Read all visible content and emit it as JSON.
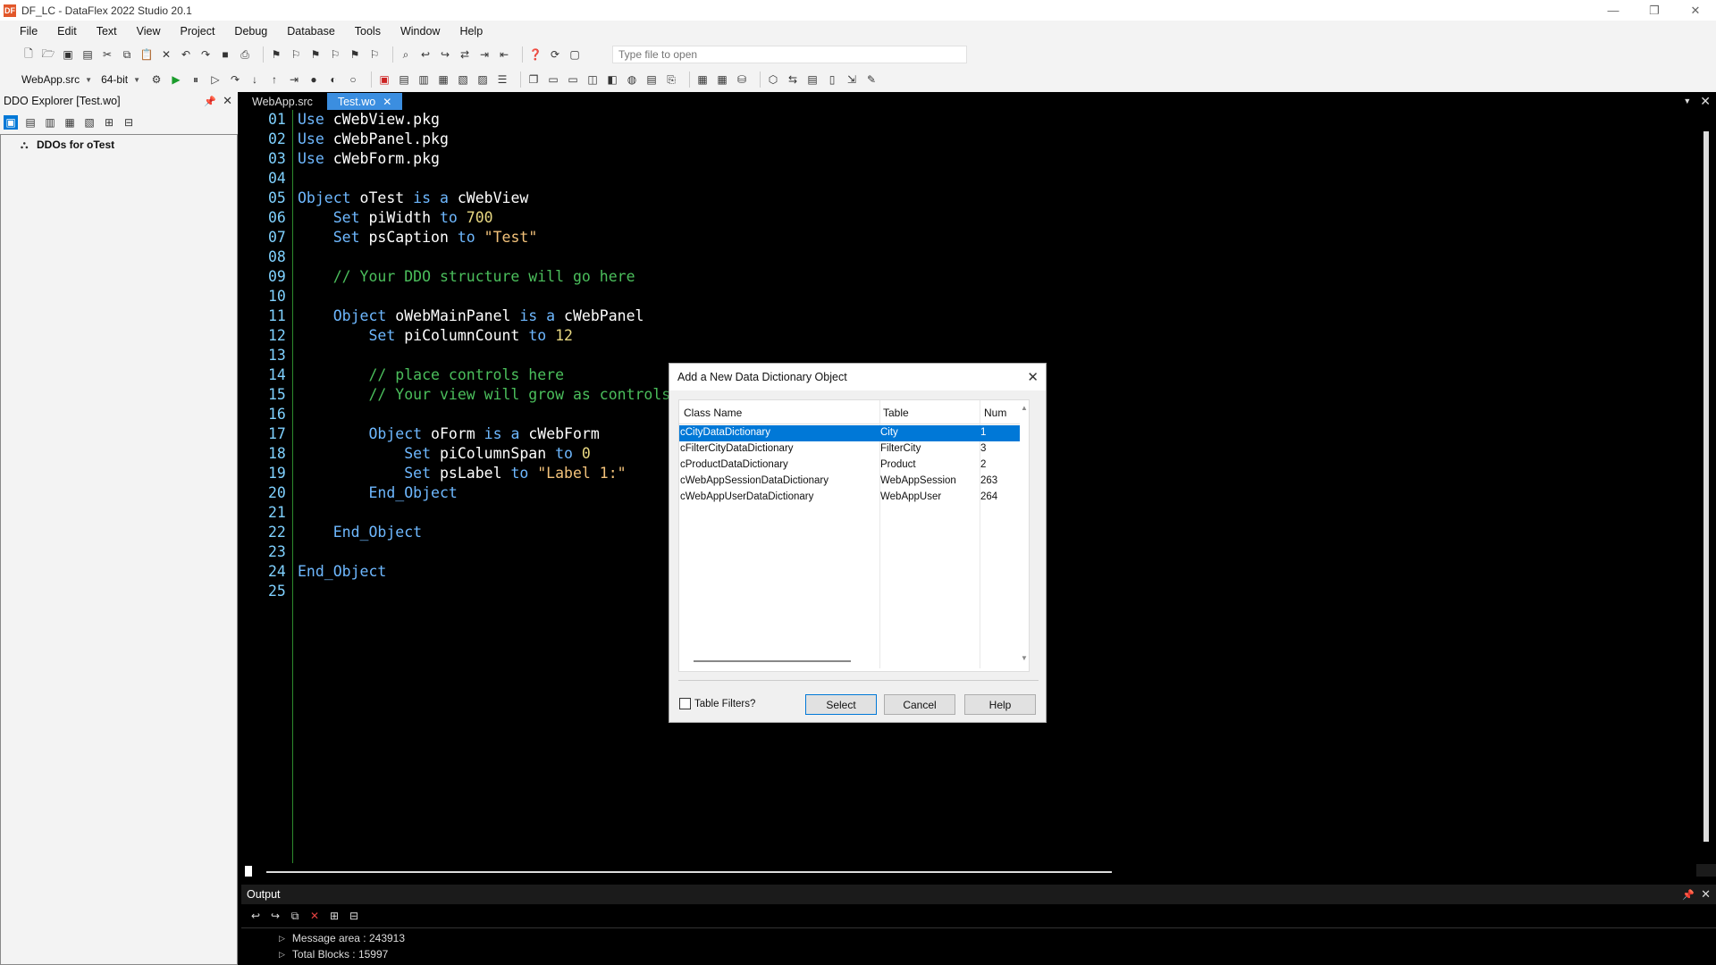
{
  "window": {
    "title": "DF_LC - DataFlex 2022 Studio 20.1",
    "app_icon": "DF",
    "controls": [
      "—",
      "❐",
      "✕"
    ]
  },
  "menu": [
    "File",
    "Edit",
    "Text",
    "View",
    "Project",
    "Debug",
    "Database",
    "Tools",
    "Window",
    "Help"
  ],
  "toolbar": {
    "open_file_placeholder": "Type file to open",
    "project_combo": "WebApp.src",
    "bitness_combo": "64-bit"
  },
  "ddo_explorer": {
    "title": "DDO Explorer [Test.wo]",
    "tree_root": "DDOs for oTest"
  },
  "tabs": [
    {
      "label": "WebApp.src",
      "active": false
    },
    {
      "label": "Test.wo",
      "active": true
    }
  ],
  "editor": {
    "line_numbers": [
      "01",
      "02",
      "03",
      "04",
      "05",
      "06",
      "07",
      "08",
      "09",
      "10",
      "11",
      "12",
      "13",
      "14",
      "15",
      "16",
      "17",
      "18",
      "19",
      "20",
      "21",
      "22",
      "23",
      "24",
      "25"
    ]
  },
  "output": {
    "title": "Output",
    "lines": [
      "Message area  : 243913",
      "Total Blocks  : 15997"
    ]
  },
  "dialog": {
    "title": "Add a New Data Dictionary Object",
    "columns": [
      "Class Name",
      "Table",
      "Num"
    ],
    "rows": [
      {
        "class": "cCityDataDictionary",
        "table": "City",
        "num": "1",
        "selected": true
      },
      {
        "class": "cFilterCityDataDictionary",
        "table": "FilterCity",
        "num": "3",
        "selected": false
      },
      {
        "class": "cProductDataDictionary",
        "table": "Product",
        "num": "2",
        "selected": false
      },
      {
        "class": "cWebAppSessionDataDictionary",
        "table": "WebAppSession",
        "num": "263",
        "selected": false
      },
      {
        "class": "cWebAppUserDataDictionary",
        "table": "WebAppUser",
        "num": "264",
        "selected": false
      }
    ],
    "table_filters_label": "Table Filters?",
    "select_label": "Select",
    "cancel_label": "Cancel",
    "help_label": "Help"
  },
  "colors": {
    "selection": "#0078d7",
    "active_tab": "#3b8ee0",
    "keyword": "#6eb8ff",
    "comment": "#4bbf5c",
    "string": "#f3c27a"
  }
}
